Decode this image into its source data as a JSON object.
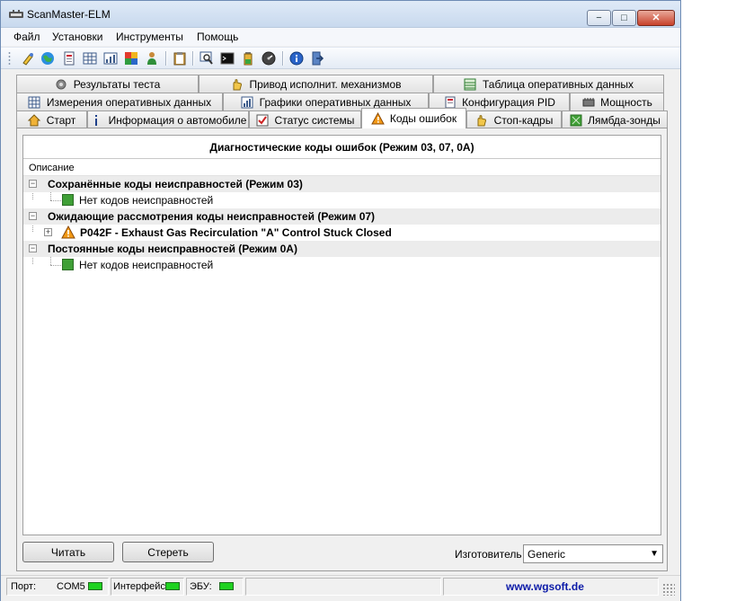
{
  "window": {
    "title": "ScanMaster-ELM",
    "controls": {
      "minimize": "−",
      "maximize": "□",
      "close": "✕"
    }
  },
  "menu": [
    "Файл",
    "Установки",
    "Инструменты",
    "Помощь"
  ],
  "toolbar": {
    "icons": [
      "connect-icon",
      "globe-icon",
      "document-icon",
      "grid-icon",
      "chart-icon",
      "dashboard-icon",
      "person-icon",
      "clipboard-icon",
      "search-icon",
      "terminal-icon",
      "battery-icon",
      "gauge-icon",
      "info-icon",
      "exit-icon"
    ]
  },
  "tabs": {
    "row1": [
      "Результаты теста",
      "Привод исполнит. механизмов",
      "Таблица оперативных данных"
    ],
    "row2": [
      "Измерения оперативных данных",
      "Графики оперативных данных",
      "Конфигурация PID",
      "Мощность"
    ],
    "row3": [
      "Старт",
      "Информация о автомобиле",
      "Статус системы",
      "Коды ошибок",
      "Стоп-кадры",
      "Лямбда-зонды"
    ],
    "active": "Коды ошибок"
  },
  "dtc": {
    "title": "Диагностические коды ошибок (Режим 03, 07, 0A)",
    "column": "Описание",
    "groups": [
      {
        "label": "Сохранённые коды неисправностей (Режим 03)",
        "child": "Нет кодов неисправностей"
      },
      {
        "label": "Ожидающие рассмотрения коды неисправностей (Режим 07)",
        "child": "P042F - Exhaust Gas Recirculation \"A\" Control Stuck Closed"
      },
      {
        "label": "Постоянные коды неисправностей  (Режим 0A)",
        "child": "Нет кодов неисправностей"
      }
    ],
    "expander_expanded": "−",
    "expander_collapsed": "+"
  },
  "buttons": {
    "read": "Читать",
    "erase": "Стереть"
  },
  "manufacturer": {
    "label": "Изготовитель",
    "value": "Generic",
    "arrow": "▼"
  },
  "statusbar": {
    "port_label": "Порт:",
    "port_value": "COM5",
    "interface_label": "Интерфейс:",
    "ecu_label": "ЭБУ:",
    "link": "www.wgsoft.de",
    "led_color": "#1fd221"
  }
}
